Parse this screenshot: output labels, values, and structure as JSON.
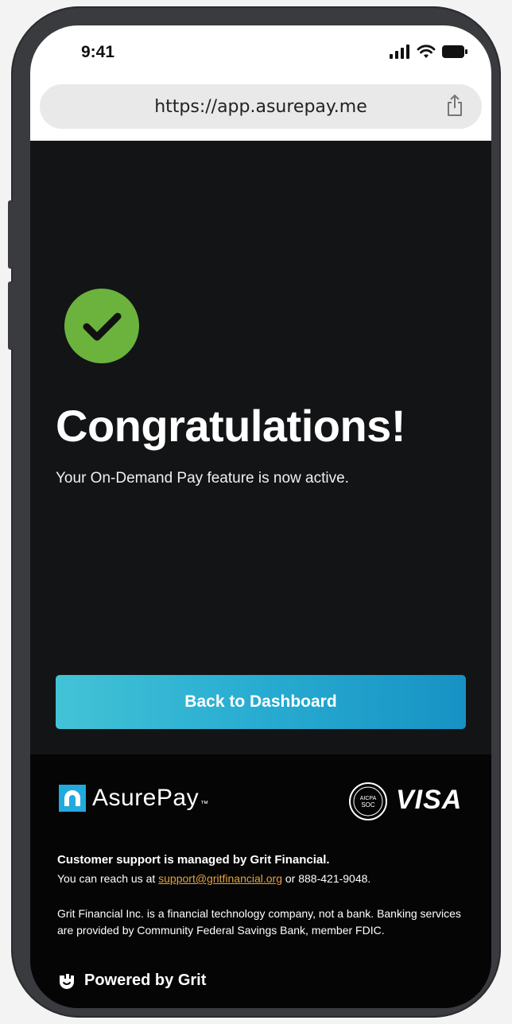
{
  "status_bar": {
    "time": "9:41"
  },
  "browser": {
    "url": "https://app.asurepay.me"
  },
  "main": {
    "title": "Congratulations!",
    "subtitle": "Your On-Demand Pay feature is now active.",
    "cta_label": "Back to Dashboard"
  },
  "footer": {
    "brand_name": "AsurePay",
    "brand_tm": "™",
    "soc_badge_text": "AICPA SOC",
    "visa_label": "VISA",
    "support_title": "Customer support is managed by Grit Financial.",
    "support_prefix": "You can reach us at ",
    "support_email": "support@gritfinancial.org",
    "support_suffix": " or 888-421-9048.",
    "disclaimer": "Grit Financial Inc. is a financial technology company, not a bank. Banking services are provided by Community Federal Savings Bank, member FDIC.",
    "powered_by": "Powered by Grit"
  },
  "colors": {
    "success_green": "#6cb33e",
    "cta_start": "#43c3d6",
    "cta_end": "#1692c4",
    "link_color": "#e6a23c"
  },
  "icons": [
    "signal-icon",
    "wifi-icon",
    "battery-icon",
    "share-icon",
    "check-circle-icon",
    "asurepay-logo-icon",
    "grit-logo-icon"
  ]
}
